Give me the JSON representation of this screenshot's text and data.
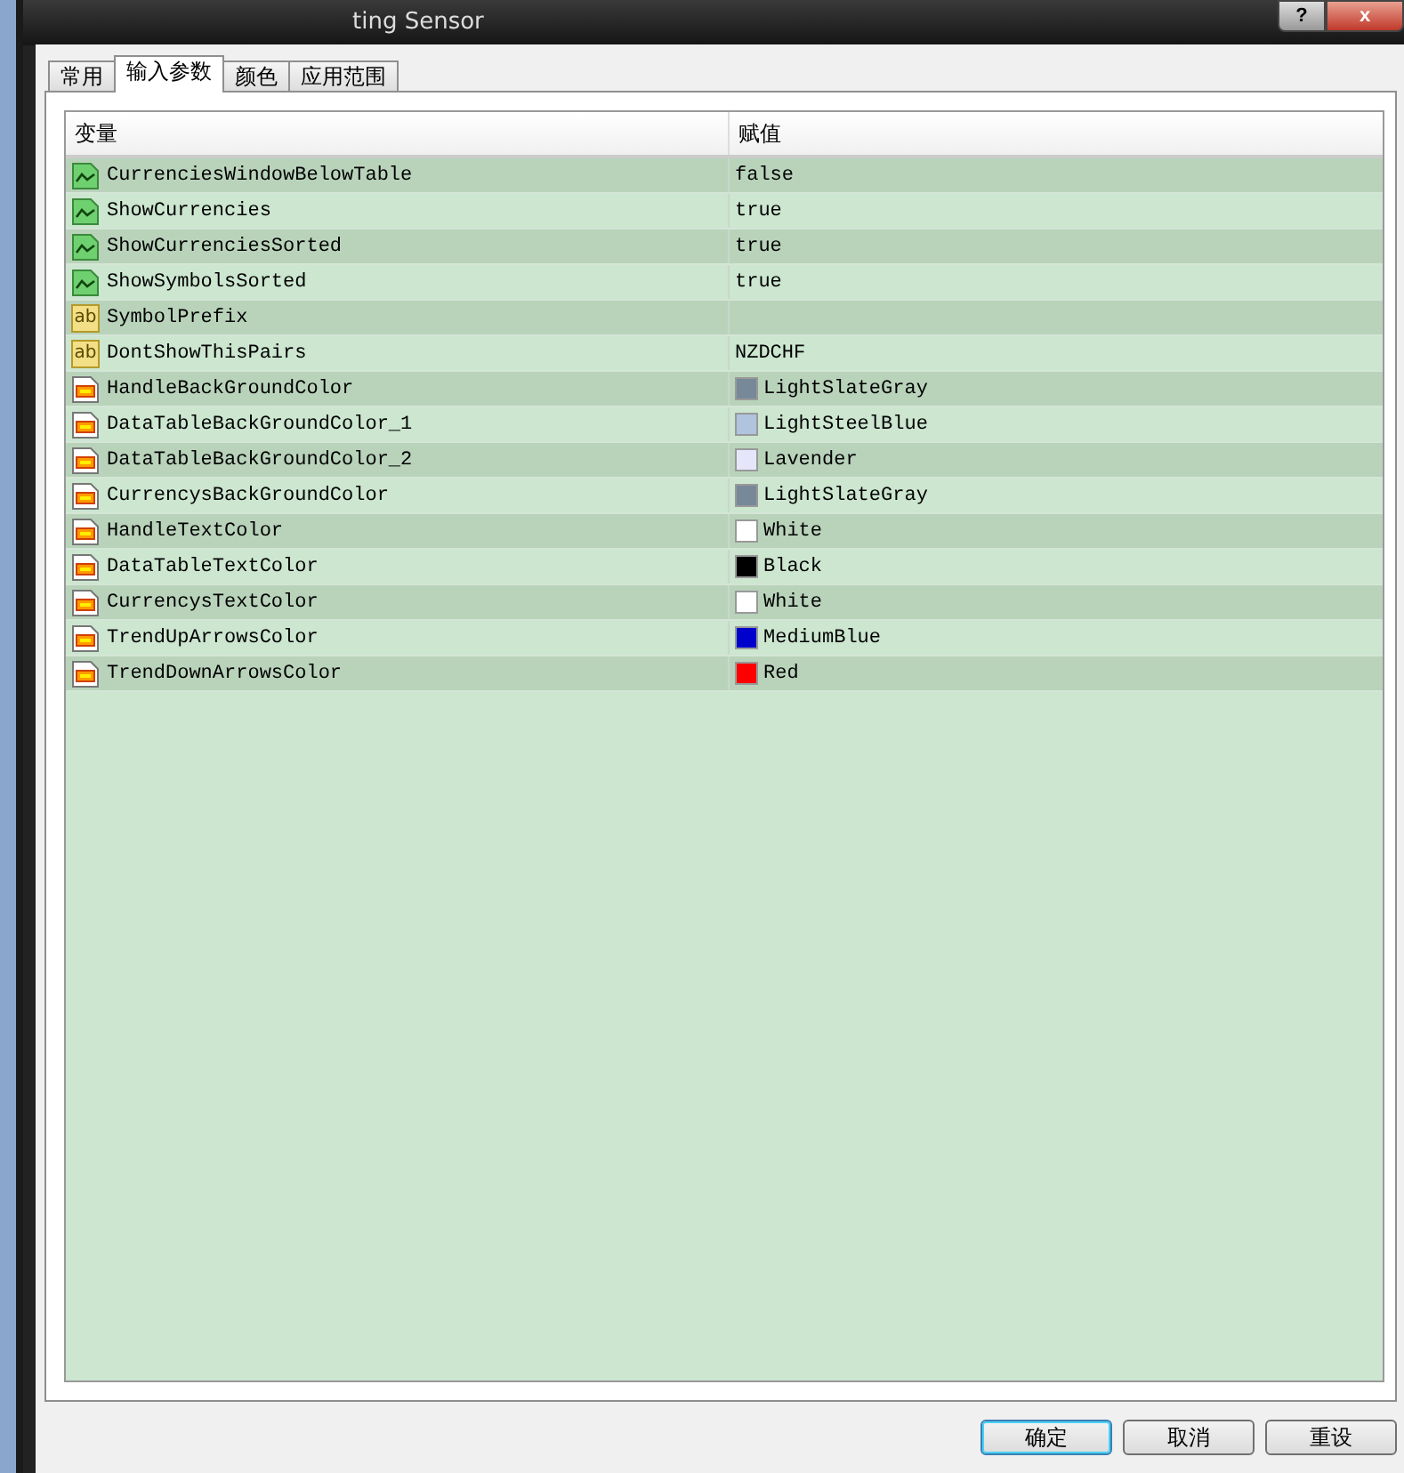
{
  "window": {
    "title": "ting Sensor",
    "help_button": "?",
    "close_button": "x"
  },
  "tabs": [
    {
      "label": "常用",
      "selected": false
    },
    {
      "label": "输入参数",
      "selected": true
    },
    {
      "label": "颜色",
      "selected": false
    },
    {
      "label": "应用范围",
      "selected": false
    }
  ],
  "table": {
    "columns": [
      "变量",
      "赋值"
    ],
    "rows": [
      {
        "kind": "bool",
        "name": "CurrenciesWindowBelowTable",
        "value": "false"
      },
      {
        "kind": "bool",
        "name": "ShowCurrencies",
        "value": "true"
      },
      {
        "kind": "bool",
        "name": "ShowCurrenciesSorted",
        "value": "true"
      },
      {
        "kind": "bool",
        "name": "ShowSymbolsSorted",
        "value": "true"
      },
      {
        "kind": "string",
        "icon_label": "ab",
        "name": "SymbolPrefix"
      },
      {
        "kind": "string",
        "icon_label": "ab",
        "name": "DontShowThisPairs",
        "value": "NZDCHF"
      },
      {
        "kind": "color",
        "name": "HandleBackGroundColor",
        "value": "LightSlateGray",
        "color": "#778899"
      },
      {
        "kind": "color",
        "name": "DataTableBackGroundColor_1",
        "value": "LightSteelBlue",
        "color": "#b0c4de"
      },
      {
        "kind": "color",
        "name": "DataTableBackGroundColor_2",
        "value": "Lavender",
        "color": "#e6e6fa"
      },
      {
        "kind": "color",
        "name": "CurrencysBackGroundColor",
        "value": "LightSlateGray",
        "color": "#778899"
      },
      {
        "kind": "color",
        "name": "HandleTextColor",
        "value": "White",
        "color": "#ffffff"
      },
      {
        "kind": "color",
        "name": "DataTableTextColor",
        "value": "Black",
        "color": "#000000"
      },
      {
        "kind": "color",
        "name": "CurrencysTextColor",
        "value": "White",
        "color": "#ffffff"
      },
      {
        "kind": "color",
        "name": "TrendUpArrowsColor",
        "value": "MediumBlue",
        "color": "#0000cd"
      },
      {
        "kind": "color",
        "name": "TrendDownArrowsColor",
        "value": "Red",
        "color": "#ff0000"
      }
    ]
  },
  "buttons": [
    {
      "label": "确定",
      "default": true
    },
    {
      "label": "取消",
      "default": false
    },
    {
      "label": "重设",
      "default": false
    }
  ]
}
